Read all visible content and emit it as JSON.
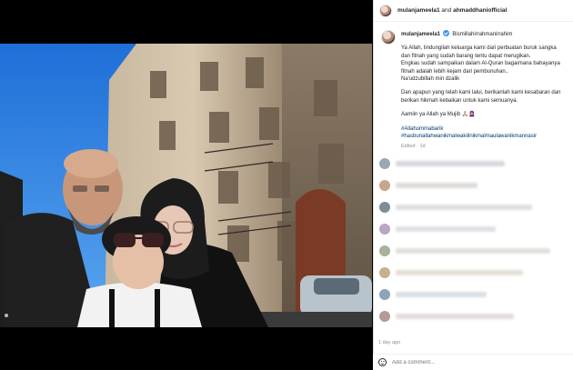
{
  "header": {
    "user1": "mulanjameela1",
    "conjunction": "and",
    "user2": "ahmaddhaniofficial"
  },
  "caption": {
    "username": "mulanjameela1",
    "line1": "Bismillahirrahmanirrahim",
    "para1": "Ya Allah, lindungilah keluarga kami dari perbuatan buruk sangka dan fitnah yang sudah barang tentu dapat merugikan.",
    "para1b": "Engkau sudah sampaikan dalam Al-Quran bagaimana bahayanya fitnah adalah lebih kejam dari pembunuhan..",
    "para1c": "Na'udzubillah min dzalik",
    "para2": "Dan apapun yang telah kami lalui, berikanlah kami kesabaran dan berikan hikmah kebaikan untuk kami semuanya.",
    "para3": "Aamiin ya Allah ya Mujib 🙏🏼🧕",
    "hashtags": [
      "#Allahummabarik",
      "#hasbunallahwanikmalwakiilnikmalmaulawanikmannasir"
    ],
    "edited": "Edited · 1d"
  },
  "footer": {
    "time": "1 day ago",
    "comment_placeholder": "Add a comment..."
  },
  "icons": {
    "verified": "verified-badge-icon",
    "emoji": "smiley-face-icon"
  },
  "colors": {
    "accent": "#3897f0",
    "hashtag": "#00376b",
    "muted": "#8e8e8e"
  }
}
